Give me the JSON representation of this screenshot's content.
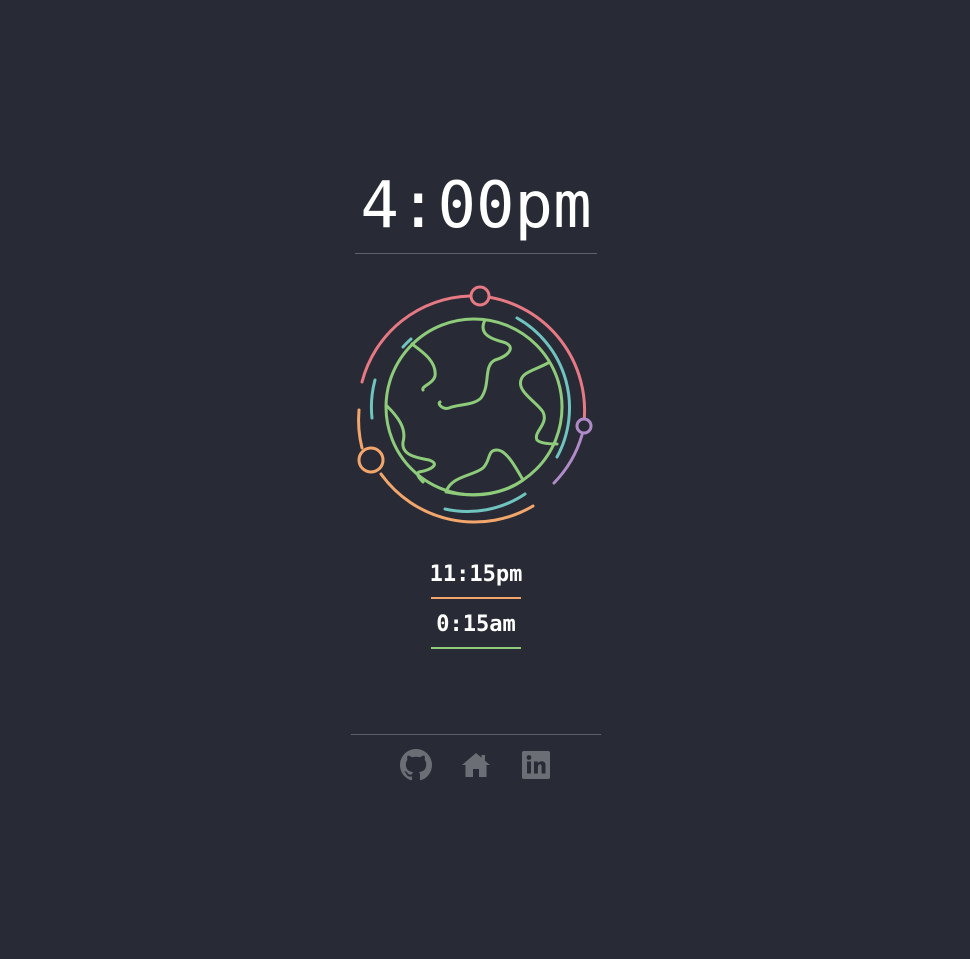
{
  "clock": {
    "main_time": "4:00pm"
  },
  "zones": [
    {
      "time": "11:15pm",
      "color": "#f2a66c"
    },
    {
      "time": "0:15am",
      "color": "#8ecb7a"
    }
  ],
  "globe": {
    "ring_colors": {
      "red": "#e67983",
      "purple": "#b18bc8",
      "orange": "#f2a66c",
      "teal": "#6fc4c0",
      "green": "#8ecb7a"
    }
  },
  "footer": {
    "links": [
      {
        "icon": "github-icon"
      },
      {
        "icon": "home-icon"
      },
      {
        "icon": "linkedin-icon"
      }
    ],
    "icon_color": "#6b6e75"
  }
}
